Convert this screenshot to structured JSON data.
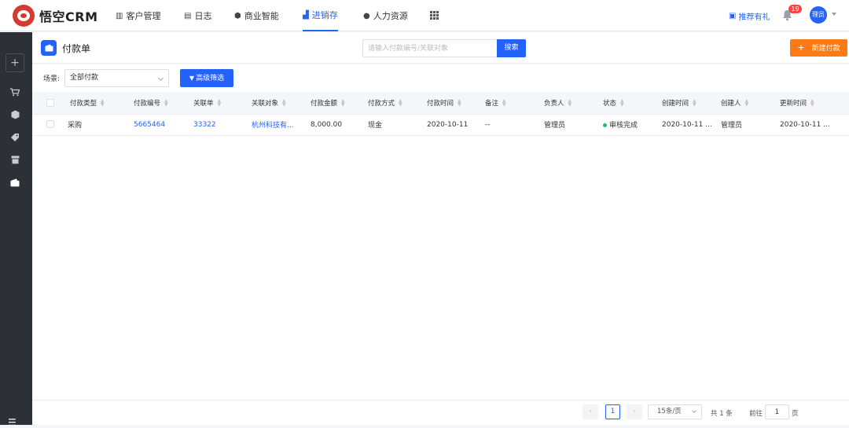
{
  "app": {
    "title": "悟空CRM"
  },
  "nav": [
    {
      "label": "客户管理",
      "icon": "building-icon"
    },
    {
      "label": "日志",
      "icon": "journal-icon"
    },
    {
      "label": "商业智能",
      "icon": "shield-check-icon"
    },
    {
      "label": "进销存",
      "icon": "chart-icon",
      "active": true
    },
    {
      "label": "人力资源",
      "icon": "people-icon"
    }
  ],
  "header_right": {
    "gift_label": "推荐有礼",
    "notification_count": "19",
    "avatar_text": "理员"
  },
  "page": {
    "title": "付款单",
    "search_placeholder": "请输入付款编号/关联对象",
    "search_label": "搜索",
    "new_label": "新建付款"
  },
  "filter": {
    "scene_label": "场景:",
    "scene_value": "全部付款",
    "advanced_label": "高级筛选"
  },
  "table": {
    "columns": [
      "付款类型",
      "付款编号",
      "关联单",
      "关联对象",
      "付款金额",
      "付款方式",
      "付款时间",
      "备注",
      "负责人",
      "状态",
      "创建时间",
      "创建人",
      "更新时间"
    ],
    "rows": [
      {
        "type": "采购",
        "number": "5665464",
        "related_order": "33322",
        "related_object": "杭州科技有...",
        "amount": "8,000.00",
        "method": "现金",
        "pay_time": "2020-10-11",
        "remark": "--",
        "owner": "管理员",
        "status": "审核完成",
        "created_at": "2020-10-11 ...",
        "creator": "管理员",
        "updated_at": "2020-10-11 ..."
      }
    ]
  },
  "pagination": {
    "current_page": "1",
    "page_size": "15条/页",
    "total": "共 1 条",
    "goto_label": "前往",
    "goto_value": "1",
    "page_suffix": "页"
  },
  "colors": {
    "primary": "#2362fb",
    "new_button": "#fe7a14",
    "sidebar": "#2d3037",
    "status_ok": "#19be6b",
    "badge": "#f5483b"
  }
}
